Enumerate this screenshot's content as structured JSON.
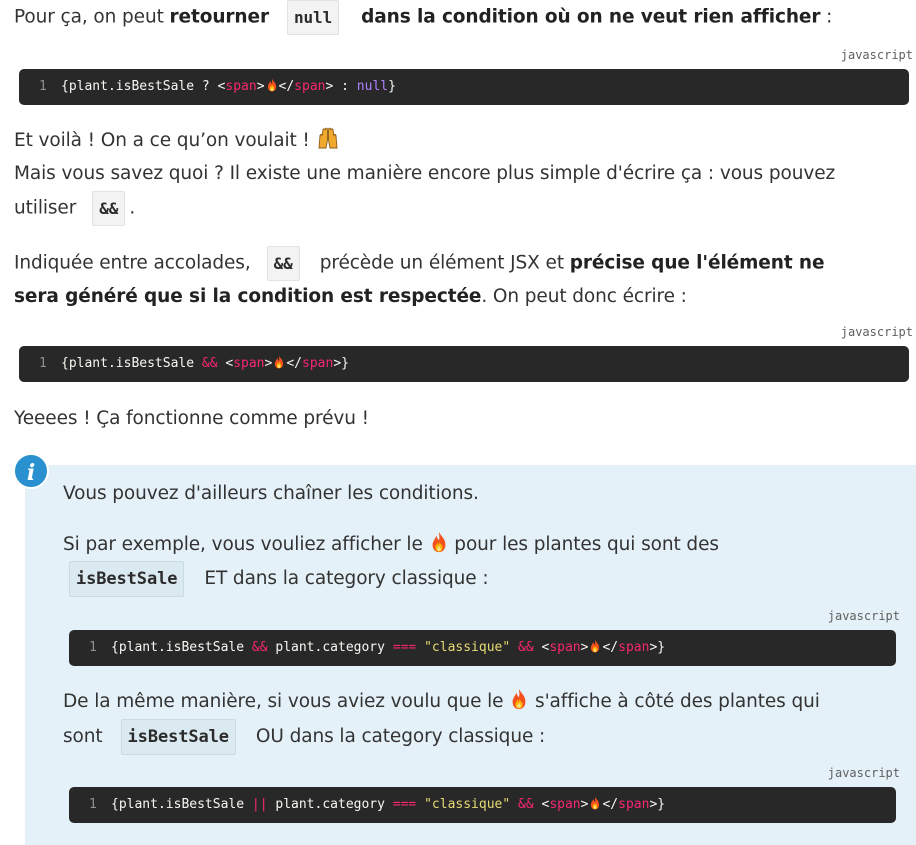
{
  "intro": {
    "part1": "Pour ça, on peut ",
    "bold1": "retourner",
    "code": "null",
    "bold2": "dans la condition où on ne veut rien afficher",
    "end": " :"
  },
  "block1": {
    "language": "javascript",
    "line_number": "1",
    "tokens": {
      "a": "{plant.isBestSale ? <",
      "tag1": "span",
      "b": ">",
      "c": "</",
      "tag2": "span",
      "d": "> : ",
      "kw": "null",
      "e": "}"
    }
  },
  "voila": {
    "text": "Et voilà ! On a ce qu’on voulait ! ",
    "emoji_name": "raised-hands-icon"
  },
  "simpler": {
    "line1": "Mais vous savez quoi ? Il existe une manière encore plus simple d'écrire ça : vous pouvez",
    "line2_start": "utiliser",
    "code": "&&",
    "line2_end": "."
  },
  "indicated": {
    "start": "Indiquée entre accolades,",
    "code": "&&",
    "mid": "précède un élément JSX et ",
    "bold_line1": "précise que l'élément ne",
    "bold_line2": "sera généré que si la condition est respectée",
    "end": ". On peut donc écrire :"
  },
  "block2": {
    "language": "javascript",
    "line_number": "1",
    "tokens": {
      "a": "{plant.isBestSale ",
      "op": "&&",
      "b": " <",
      "tag1": "span",
      "c": ">",
      "d": "</",
      "tag2": "span",
      "e": ">}"
    }
  },
  "yes": {
    "text": "Yeeees ! Ça fonctionne comme prévu !"
  },
  "info": {
    "badge": "i",
    "line1": "Vous pouvez d'ailleurs chaîner les conditions.",
    "para2_start": "Si par exemple, vous vouliez afficher le ",
    "para2_mid": " pour les plantes qui sont des",
    "para2_code": "isBestSale",
    "para2_end": "ET dans la category classique :",
    "block3": {
      "language": "javascript",
      "line_number": "1",
      "tokens": {
        "a": "{plant.isBestSale ",
        "op1": "&&",
        "b": " plant.category ",
        "op2": "===",
        "c": " ",
        "str": "\"classique\"",
        "d": " ",
        "op3": "&&",
        "e": " <",
        "tag1": "span",
        "f": ">",
        "g": "</",
        "tag2": "span",
        "h": ">}"
      }
    },
    "para3_start": "De la même manière, si vous aviez voulu que le ",
    "para3_mid": " s'affiche à côté des plantes qui",
    "para3_line2_start": "sont",
    "para3_code": "isBestSale",
    "para3_end": "OU dans la category classique :",
    "block4": {
      "language": "javascript",
      "line_number": "1",
      "tokens": {
        "a": "{plant.isBestSale ",
        "op1": "||",
        "b": " plant.category ",
        "op2": "===",
        "c": " ",
        "str": "\"classique\"",
        "d": " ",
        "op3": "&&",
        "e": " <",
        "tag1": "span",
        "f": ">",
        "g": "</",
        "tag2": "span",
        "h": ">}"
      }
    }
  },
  "colors": {
    "code_background": "#282828",
    "info_background": "#e5f1f8",
    "info_badge": "#2a91d0",
    "tag": "#f92672",
    "keyword": "#ae81ff",
    "string": "#e6db74"
  },
  "icons": {
    "fire": "fire-emoji-icon",
    "hands": "raised-hands-icon",
    "info": "info-icon"
  }
}
